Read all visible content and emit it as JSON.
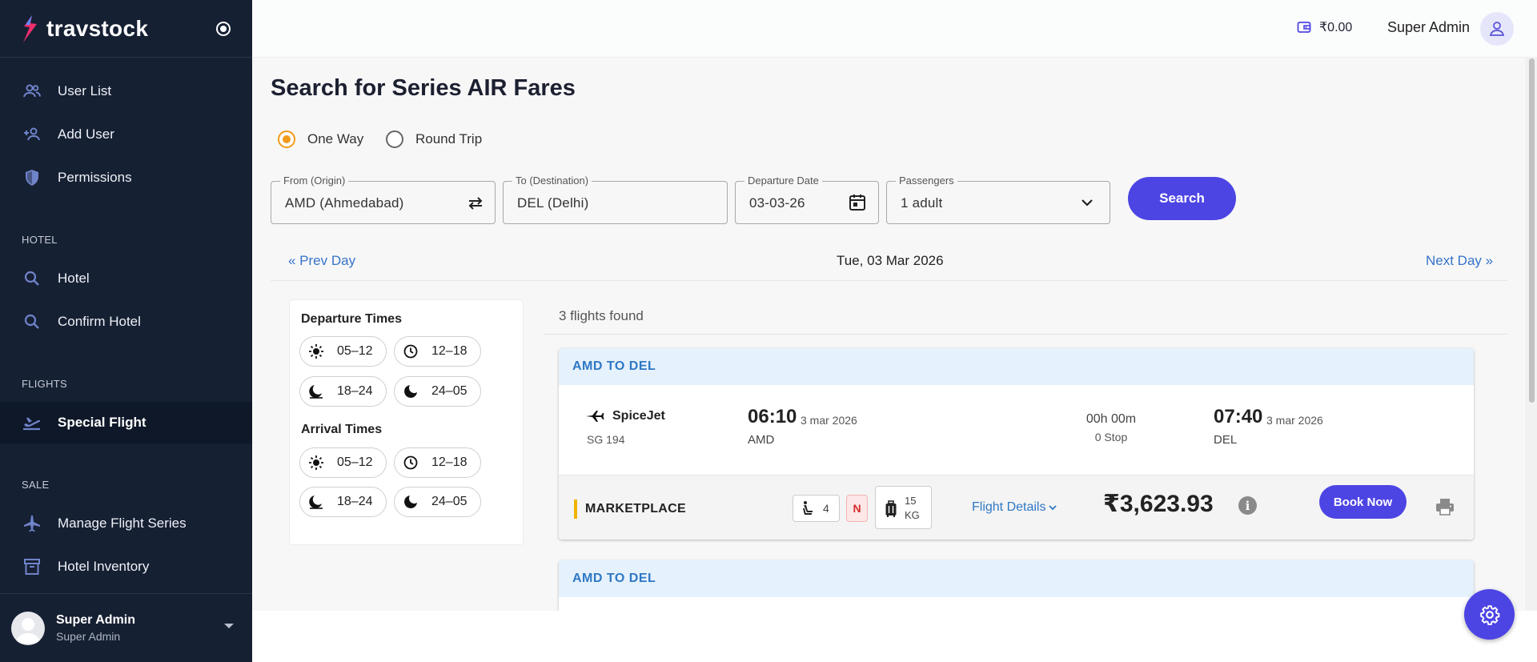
{
  "brand": {
    "name": "travstock",
    "logo_icon": "flame-logo-icon",
    "toggle_icon": "radio-toggle-icon"
  },
  "sidebar": {
    "items_top": [
      {
        "label": "User List",
        "icon": "users-icon"
      },
      {
        "label": "Add User",
        "icon": "add-user-icon"
      },
      {
        "label": "Permissions",
        "icon": "shield-icon"
      }
    ],
    "section_hotel": "HOTEL",
    "items_hotel": [
      {
        "label": "Hotel",
        "icon": "search-icon"
      },
      {
        "label": "Confirm Hotel",
        "icon": "search-icon"
      }
    ],
    "section_flights": "FLIGHTS",
    "items_flights": [
      {
        "label": "Special Flight",
        "icon": "flight-takeoff-icon",
        "active": true
      }
    ],
    "section_sale": "SALE",
    "items_sale": [
      {
        "label": "Manage Flight Series",
        "icon": "airplane-icon"
      },
      {
        "label": "Hotel Inventory",
        "icon": "archive-icon"
      }
    ],
    "user": {
      "name": "Super Admin",
      "role": "Super Admin"
    }
  },
  "topbar": {
    "wallet": "₹0.00",
    "user_name": "Super Admin"
  },
  "search": {
    "title": "Search for Series AIR Fares",
    "trip_types": [
      {
        "label": "One Way",
        "checked": true
      },
      {
        "label": "Round Trip",
        "checked": false
      }
    ],
    "from": {
      "label": "From (Origin)",
      "value": "AMD (Ahmedabad)"
    },
    "to": {
      "label": "To (Destination)",
      "value": "DEL (Delhi)"
    },
    "date": {
      "label": "Departure Date",
      "value": "03-03-26"
    },
    "passengers": {
      "label": "Passengers",
      "value": "1 adult"
    },
    "button": "Search"
  },
  "day_nav": {
    "prev": "« Prev Day",
    "current": "Tue, 03 Mar 2026",
    "next": "Next Day »"
  },
  "filters": {
    "departure_title": "Departure Times",
    "arrival_title": "Arrival Times",
    "slots": [
      {
        "label": "05–12",
        "icon": "sun-icon"
      },
      {
        "label": "12–18",
        "icon": "clock-icon"
      },
      {
        "label": "18–24",
        "icon": "evening-moon-icon"
      },
      {
        "label": "24–05",
        "icon": "moon-icon"
      }
    ]
  },
  "results": {
    "count_text": "3 flights found",
    "cards": [
      {
        "route": "AMD TO DEL",
        "airline": "SpiceJet",
        "flight_no": "SG 194",
        "dep_time": "06:10",
        "dep_date": "3 mar 2026",
        "dep_code": "AMD",
        "duration": "00h 00m",
        "stops": "0 Stop",
        "arr_time": "07:40",
        "arr_date": "3 mar 2026",
        "arr_code": "DEL",
        "fare_type": "MARKETPLACE",
        "seats": "4",
        "fare_class": "N",
        "baggage_1": "15",
        "baggage_2": "KG",
        "details_label": "Flight Details",
        "price": "₹3,623.93",
        "info": "i",
        "book_label": "Book Now"
      },
      {
        "route": "AMD TO DEL"
      }
    ]
  },
  "colors": {
    "sidebar_bg": "#162033",
    "accent": "#4d44e4",
    "radio": "#f29a1a",
    "link": "#2e78c5",
    "route_header_bg": "#e5f1fc"
  }
}
